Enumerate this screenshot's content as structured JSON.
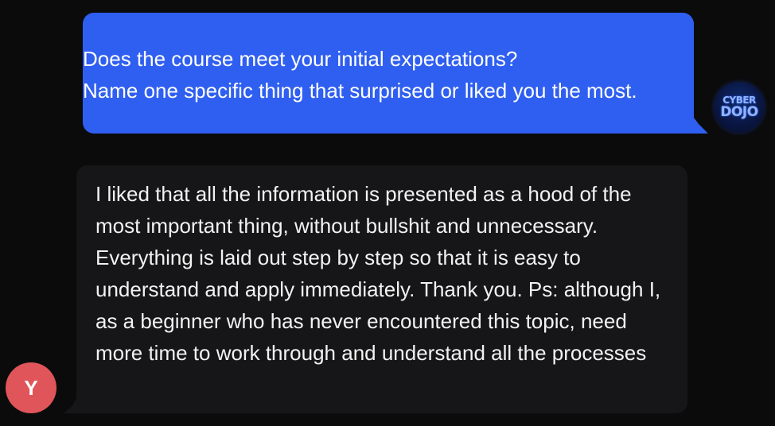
{
  "messages": [
    {
      "sender": "bot",
      "avatar_text_line1": "CYBER",
      "avatar_text_line2": "DOJO",
      "text": "Does the course meet your initial expectations?\nName one specific thing that surprised or liked you the most.",
      "bubble_color": "#2f5ff0"
    },
    {
      "sender": "user",
      "avatar_initial": "Y",
      "avatar_color": "#e0555a",
      "text": "I liked that all the information is presented as a hood of the most important thing, without bullshit and unnecessary. Everything is laid out step by step so that it is easy to understand and apply immediately. Thank you. Ps: although I, as a beginner who has never encountered this topic, need more time to work through and understand all the processes",
      "bubble_color": "#161618"
    }
  ]
}
